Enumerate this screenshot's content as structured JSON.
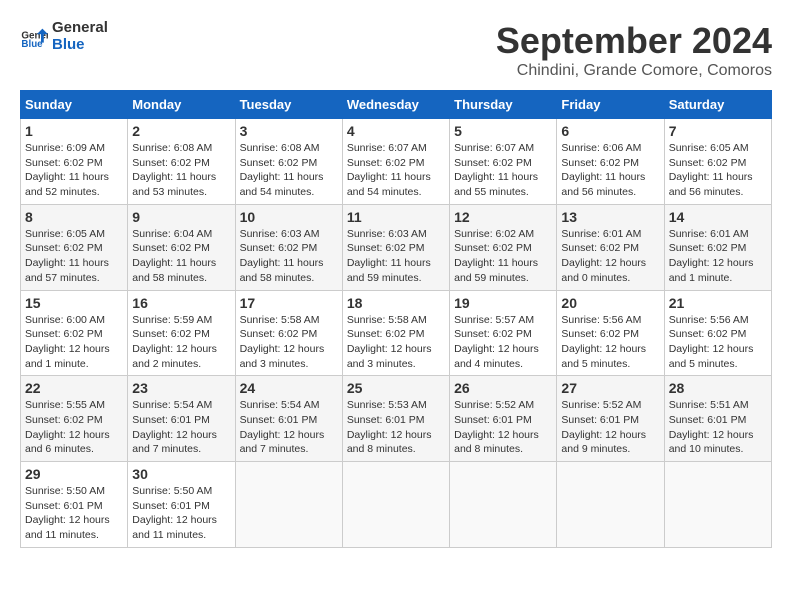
{
  "header": {
    "logo_general": "General",
    "logo_blue": "Blue",
    "month_title": "September 2024",
    "location": "Chindini, Grande Comore, Comoros"
  },
  "weekdays": [
    "Sunday",
    "Monday",
    "Tuesday",
    "Wednesday",
    "Thursday",
    "Friday",
    "Saturday"
  ],
  "weeks": [
    [
      {
        "day": "1",
        "info": "Sunrise: 6:09 AM\nSunset: 6:02 PM\nDaylight: 11 hours and 52 minutes."
      },
      {
        "day": "2",
        "info": "Sunrise: 6:08 AM\nSunset: 6:02 PM\nDaylight: 11 hours and 53 minutes."
      },
      {
        "day": "3",
        "info": "Sunrise: 6:08 AM\nSunset: 6:02 PM\nDaylight: 11 hours and 54 minutes."
      },
      {
        "day": "4",
        "info": "Sunrise: 6:07 AM\nSunset: 6:02 PM\nDaylight: 11 hours and 54 minutes."
      },
      {
        "day": "5",
        "info": "Sunrise: 6:07 AM\nSunset: 6:02 PM\nDaylight: 11 hours and 55 minutes."
      },
      {
        "day": "6",
        "info": "Sunrise: 6:06 AM\nSunset: 6:02 PM\nDaylight: 11 hours and 56 minutes."
      },
      {
        "day": "7",
        "info": "Sunrise: 6:05 AM\nSunset: 6:02 PM\nDaylight: 11 hours and 56 minutes."
      }
    ],
    [
      {
        "day": "8",
        "info": "Sunrise: 6:05 AM\nSunset: 6:02 PM\nDaylight: 11 hours and 57 minutes."
      },
      {
        "day": "9",
        "info": "Sunrise: 6:04 AM\nSunset: 6:02 PM\nDaylight: 11 hours and 58 minutes."
      },
      {
        "day": "10",
        "info": "Sunrise: 6:03 AM\nSunset: 6:02 PM\nDaylight: 11 hours and 58 minutes."
      },
      {
        "day": "11",
        "info": "Sunrise: 6:03 AM\nSunset: 6:02 PM\nDaylight: 11 hours and 59 minutes."
      },
      {
        "day": "12",
        "info": "Sunrise: 6:02 AM\nSunset: 6:02 PM\nDaylight: 11 hours and 59 minutes."
      },
      {
        "day": "13",
        "info": "Sunrise: 6:01 AM\nSunset: 6:02 PM\nDaylight: 12 hours and 0 minutes."
      },
      {
        "day": "14",
        "info": "Sunrise: 6:01 AM\nSunset: 6:02 PM\nDaylight: 12 hours and 1 minute."
      }
    ],
    [
      {
        "day": "15",
        "info": "Sunrise: 6:00 AM\nSunset: 6:02 PM\nDaylight: 12 hours and 1 minute."
      },
      {
        "day": "16",
        "info": "Sunrise: 5:59 AM\nSunset: 6:02 PM\nDaylight: 12 hours and 2 minutes."
      },
      {
        "day": "17",
        "info": "Sunrise: 5:58 AM\nSunset: 6:02 PM\nDaylight: 12 hours and 3 minutes."
      },
      {
        "day": "18",
        "info": "Sunrise: 5:58 AM\nSunset: 6:02 PM\nDaylight: 12 hours and 3 minutes."
      },
      {
        "day": "19",
        "info": "Sunrise: 5:57 AM\nSunset: 6:02 PM\nDaylight: 12 hours and 4 minutes."
      },
      {
        "day": "20",
        "info": "Sunrise: 5:56 AM\nSunset: 6:02 PM\nDaylight: 12 hours and 5 minutes."
      },
      {
        "day": "21",
        "info": "Sunrise: 5:56 AM\nSunset: 6:02 PM\nDaylight: 12 hours and 5 minutes."
      }
    ],
    [
      {
        "day": "22",
        "info": "Sunrise: 5:55 AM\nSunset: 6:02 PM\nDaylight: 12 hours and 6 minutes."
      },
      {
        "day": "23",
        "info": "Sunrise: 5:54 AM\nSunset: 6:01 PM\nDaylight: 12 hours and 7 minutes."
      },
      {
        "day": "24",
        "info": "Sunrise: 5:54 AM\nSunset: 6:01 PM\nDaylight: 12 hours and 7 minutes."
      },
      {
        "day": "25",
        "info": "Sunrise: 5:53 AM\nSunset: 6:01 PM\nDaylight: 12 hours and 8 minutes."
      },
      {
        "day": "26",
        "info": "Sunrise: 5:52 AM\nSunset: 6:01 PM\nDaylight: 12 hours and 8 minutes."
      },
      {
        "day": "27",
        "info": "Sunrise: 5:52 AM\nSunset: 6:01 PM\nDaylight: 12 hours and 9 minutes."
      },
      {
        "day": "28",
        "info": "Sunrise: 5:51 AM\nSunset: 6:01 PM\nDaylight: 12 hours and 10 minutes."
      }
    ],
    [
      {
        "day": "29",
        "info": "Sunrise: 5:50 AM\nSunset: 6:01 PM\nDaylight: 12 hours and 11 minutes."
      },
      {
        "day": "30",
        "info": "Sunrise: 5:50 AM\nSunset: 6:01 PM\nDaylight: 12 hours and 11 minutes."
      },
      {
        "day": "",
        "info": ""
      },
      {
        "day": "",
        "info": ""
      },
      {
        "day": "",
        "info": ""
      },
      {
        "day": "",
        "info": ""
      },
      {
        "day": "",
        "info": ""
      }
    ]
  ]
}
